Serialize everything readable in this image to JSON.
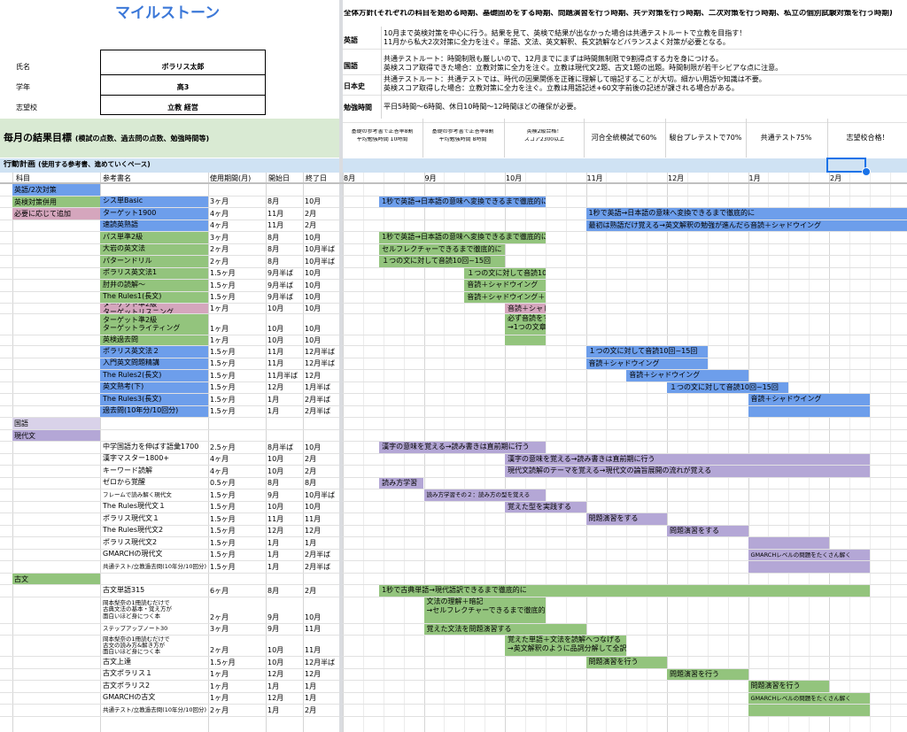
{
  "title": "マイルストーン",
  "overall_plan": {
    "heading": "全体方針(それぞれの科目を始める時期、基礎固めをする時期、問題演習を行う時期、共テ対策を行う時期、二次対策を行う時期、私立の個別試験対策を行う時期)",
    "rows": [
      {
        "label": "英語",
        "lines": [
          "10月まで英検対策を中心に行う。結果を見て、英検で結果が出なかった場合は共通テストルートで立教を目指す！",
          "11月から私大2次対策に全力を注ぐ。単語、文法、英文解釈、長文読解などバランスよく対策が必要となる。"
        ]
      },
      {
        "label": "国語",
        "lines": [
          "共通テストルート：時間制限も厳しいので、12月までにまずは時間無制限で9割得点する力を身につける。",
          "英検スコア取得できた場合：立教対策に全力を注ぐ。立教は現代文2題、古文1題の出題。時間制限が若干シビアな点に注意。"
        ]
      },
      {
        "label": "日本史",
        "lines": [
          "共通テストルート：共通テストでは、時代の因果関係を正確に理解して暗記することが大切。細かい用語や知識は不要。",
          "英検スコア取得した場合：立教対策に全力を注ぐ。立教は用語記述+60文字前後の記述が課される場合がある。"
        ]
      },
      {
        "label": "勉強時間",
        "lines": [
          "平日5時間〜6時間、休日10時間〜12時間ほどの確保が必要。"
        ]
      }
    ]
  },
  "profile": {
    "name_label": "氏名",
    "name_value": "ボラリス太郎",
    "grade_label": "学年",
    "grade_value": "高3",
    "school_label": "志望校",
    "school_value": "立教 経営"
  },
  "monthly_goals": {
    "label": "毎月の結果目標",
    "sub": "(模試の点数、過去問の点数、勉強時間等)",
    "goals": [
      {
        "lines": [
          "基礎の参考書で正答率8割",
          "平均勉強時間 10時間"
        ]
      },
      {
        "lines": [
          "基礎の参考書で正答率8割",
          "平均勉強時間 8時間"
        ]
      },
      {
        "lines": [
          "英検2級合格！",
          "スコア2300以上"
        ]
      },
      {
        "lines": [
          "河合全統模試で60%"
        ]
      },
      {
        "lines": [
          "駿台プレテストで70%"
        ]
      },
      {
        "lines": [
          "共通テスト75%"
        ]
      },
      {
        "lines": [
          "志望校合格！"
        ]
      }
    ]
  },
  "action_plan": {
    "label": "行動計画",
    "sub": "(使用する参考書、進めていくペース)"
  },
  "columns": {
    "subject": "科目",
    "book": "参考書名",
    "period": "使用期間(月)",
    "start": "開始日",
    "end": "終了日",
    "months": [
      "8月",
      "9月",
      "10月",
      "11月",
      "12月",
      "1月",
      "2月"
    ]
  },
  "accent": {
    "green": "#93c47d",
    "blue": "#6d9eeb",
    "purple": "#b4a7d6",
    "pink": "#d5a6bd",
    "selection": "#1a73e8"
  },
  "rows": [
    {
      "subject": "英語/2次対策",
      "sc": "blue",
      "book": "",
      "period": "",
      "start": "",
      "end": ""
    },
    {
      "subject": "英検対策併用",
      "sc": "green",
      "book": "シス単Basic",
      "bc": "blue",
      "period": "3ヶ月",
      "start": "8月",
      "end": "10月"
    },
    {
      "subject": "必要に応じて追加",
      "sc": "pink",
      "book": "ターゲット1900",
      "bc": "blue",
      "period": "4ヶ月",
      "start": "11月",
      "end": "2月"
    },
    {
      "subject": "",
      "book": "速読英熟語",
      "bc": "blue",
      "period": "4ヶ月",
      "start": "11月",
      "end": "2月"
    },
    {
      "subject": "",
      "book": "パス単準2級",
      "bc": "green",
      "period": "3ヶ月",
      "start": "8月",
      "end": "10月"
    },
    {
      "subject": "",
      "book": "大岩の英文法",
      "bc": "green",
      "period": "2ヶ月",
      "start": "8月",
      "end": "10月半ば"
    },
    {
      "subject": "",
      "book": "パターンドリル",
      "bc": "green",
      "period": "2ヶ月",
      "start": "8月",
      "end": "10月半ば"
    },
    {
      "subject": "",
      "book": "ポラリス英文法1",
      "bc": "green",
      "period": "1.5ヶ月",
      "start": "9月半ば",
      "end": "10月"
    },
    {
      "subject": "",
      "book": "肘井の読解〜",
      "bc": "green",
      "period": "1.5ヶ月",
      "start": "9月半ば",
      "end": "10月"
    },
    {
      "subject": "",
      "book": "The Rules1(長文)",
      "bc": "green",
      "period": "1.5ヶ月",
      "start": "9月半ば",
      "end": "10月"
    },
    {
      "subject": "",
      "book": "ターゲット準2級 / ターゲットリスニング",
      "bc": "pink",
      "period": "1ヶ月",
      "start": "10月",
      "end": "10月"
    },
    {
      "subject": "",
      "book": "ターゲット準2級 / ターゲットライティング",
      "bc": "green",
      "period": "1ヶ月",
      "start": "10月",
      "end": "10月"
    },
    {
      "subject": "",
      "book": "英検過去問",
      "bc": "green",
      "period": "1ヶ月",
      "start": "10月",
      "end": "10月"
    },
    {
      "subject": "",
      "book": "ポラリス英文法２",
      "bc": "blue",
      "period": "1.5ヶ月",
      "start": "11月",
      "end": "12月半ば"
    },
    {
      "subject": "",
      "book": "入門英文問題精講",
      "bc": "blue",
      "period": "1.5ヶ月",
      "start": "11月",
      "end": "12月半ば"
    },
    {
      "subject": "",
      "book": "The Rules2(長文)",
      "bc": "blue",
      "period": "1.5ヶ月",
      "start": "11月半ば",
      "end": "12月"
    },
    {
      "subject": "",
      "book": "英文熟考(下)",
      "bc": "blue",
      "period": "1.5ヶ月",
      "start": "12月",
      "end": "1月半ば"
    },
    {
      "subject": "",
      "book": "The Rules3(長文)",
      "bc": "blue",
      "period": "1.5ヶ月",
      "start": "1月",
      "end": "2月半ば"
    },
    {
      "subject": "",
      "book": "過去問(10年分/10回分)",
      "bc": "blue",
      "period": "1.5ヶ月",
      "start": "1月",
      "end": "2月半ば"
    },
    {
      "subject": "国語",
      "sc": "lpurple",
      "book": "",
      "period": "",
      "start": "",
      "end": ""
    },
    {
      "subject": "現代文",
      "sc": "purple",
      "book": "",
      "period": "",
      "start": "",
      "end": ""
    },
    {
      "subject": "",
      "book": "中学国語力を伸ばす語彙1700",
      "period": "2.5ヶ月",
      "start": "8月半ば",
      "end": "10月"
    },
    {
      "subject": "",
      "book": "漢字マスター1800+",
      "period": "4ヶ月",
      "start": "10月",
      "end": "2月"
    },
    {
      "subject": "",
      "book": "キーワード読解",
      "period": "4ヶ月",
      "start": "10月",
      "end": "2月"
    },
    {
      "subject": "",
      "book": "ゼロから覚醒",
      "period": "0.5ヶ月",
      "start": "8月",
      "end": "8月"
    },
    {
      "subject": "",
      "book": "フレームで読み解く現代文",
      "bookSize": "xs",
      "period": "1.5ヶ月",
      "start": "9月",
      "end": "10月半ば"
    },
    {
      "subject": "",
      "book": "The Rules現代文１",
      "period": "1.5ヶ月",
      "start": "10月",
      "end": "10月"
    },
    {
      "subject": "",
      "book": "ポラリス現代文１",
      "period": "1.5ヶ月",
      "start": "11月",
      "end": "11月"
    },
    {
      "subject": "",
      "book": "The Rules現代文2",
      "period": "1.5ヶ月",
      "start": "12月",
      "end": "12月"
    },
    {
      "subject": "",
      "book": "ポラリス現代文2",
      "period": "1.5ヶ月",
      "start": "1月",
      "end": "1月"
    },
    {
      "subject": "",
      "book": "GMARCHの現代文",
      "period": "1.5ヶ月",
      "start": "1月",
      "end": "2月半ば"
    },
    {
      "subject": "",
      "book": "共通テスト/立教過去問(10年分/10回分)",
      "bookSize": "xs",
      "period": "1.5ヶ月",
      "start": "1月",
      "end": "2月半ば"
    },
    {
      "subject": "古文",
      "sc": "green",
      "book": "",
      "period": "",
      "start": "",
      "end": ""
    },
    {
      "subject": "",
      "book": "古文単語315",
      "period": "6ヶ月",
      "start": "8月",
      "end": "2月"
    },
    {
      "subject": "",
      "book": "岡本梨奈の1冊読むだけで / 古典文法の基本・覚え方が / 面白いほど身につく本",
      "bookSize": "xs",
      "period": "2ヶ月",
      "start": "9月",
      "end": "10月"
    },
    {
      "subject": "",
      "book": "ステップアップノート30",
      "bookSize": "xs",
      "period": "3ヶ月",
      "start": "9月",
      "end": "11月"
    },
    {
      "subject": "",
      "book": "岡本梨奈の1冊読むだけで / 古文の読み方&解き方が / 面白いほど身につく本",
      "bookSize": "xs",
      "period": "2ヶ月",
      "start": "10月",
      "end": "11月"
    },
    {
      "subject": "",
      "book": "古文上達",
      "period": "1.5ヶ月",
      "start": "10月",
      "end": "12月半ば"
    },
    {
      "subject": "",
      "book": "古文ポラリス１",
      "period": "1ヶ月",
      "start": "12月",
      "end": "12月"
    },
    {
      "subject": "",
      "book": "古文ポラリス2",
      "period": "1ヶ月",
      "start": "1月",
      "end": "1月"
    },
    {
      "subject": "",
      "book": "GMARCHの古文",
      "period": "1ヶ月",
      "start": "12月",
      "end": "1月"
    },
    {
      "subject": "",
      "book": "共通テスト/立教過去問(10年分/10回分)",
      "bookSize": "xs",
      "period": "2ヶ月",
      "start": "1月",
      "end": "2月"
    }
  ],
  "bars": [
    {
      "row": 1,
      "from": 0.45,
      "to": 2.5,
      "color": "blue",
      "text": "1秒で英語→日本語の意味へ変換できるまで徹底的に"
    },
    {
      "row": 2,
      "from": 3.0,
      "to": 7.0,
      "color": "blue",
      "text": "1秒で英語→日本語の意味へ変換できるまで徹底的に"
    },
    {
      "row": 3,
      "from": 3.0,
      "to": 7.0,
      "color": "blue",
      "text": "最初は熟語だけ覚える→英文解釈の勉強が進んだら音読＋シャドウイング"
    },
    {
      "row": 4,
      "from": 0.45,
      "to": 2.5,
      "color": "green",
      "text": "1秒で英語→日本語の意味へ変換できるまで徹底的に"
    },
    {
      "row": 5,
      "from": 0.45,
      "to": 2.0,
      "color": "green",
      "text": "セルフレクチャーできるまで徹底的に"
    },
    {
      "row": 6,
      "from": 0.45,
      "to": 2.0,
      "color": "green",
      "text": "１つの文に対して音読10回~15回"
    },
    {
      "row": 7,
      "from": 1.5,
      "to": 2.5,
      "color": "green",
      "text": "１つの文に対して音読10回~15回"
    },
    {
      "row": 8,
      "from": 1.5,
      "to": 2.5,
      "color": "green",
      "text": "音読＋シャドウイング"
    },
    {
      "row": 9,
      "from": 1.5,
      "to": 2.5,
      "color": "green",
      "text": "音読＋シャドウイング＋ 要約をする"
    },
    {
      "row": 10,
      "from": 2.0,
      "to": 2.5,
      "color": "pink",
      "text": "音読＋シャドウイング"
    },
    {
      "row": 11,
      "from": 2.0,
      "to": 2.5,
      "color": "green",
      "text": "必ず音読をすること",
      "text2": "→1つの文章につき5回"
    },
    {
      "row": 12,
      "from": 2.0,
      "to": 2.5,
      "color": "green",
      "text": ""
    },
    {
      "row": 13,
      "from": 3.0,
      "to": 4.5,
      "color": "blue",
      "text": "１つの文に対して音読10回~15回"
    },
    {
      "row": 14,
      "from": 3.0,
      "to": 4.5,
      "color": "blue",
      "text": "音読＋シャドウイング"
    },
    {
      "row": 15,
      "from": 3.5,
      "to": 5.0,
      "color": "blue",
      "text": "音読＋シャドウイング"
    },
    {
      "row": 16,
      "from": 4.0,
      "to": 5.5,
      "color": "blue",
      "text": "１つの文に対して音読10回~15回"
    },
    {
      "row": 17,
      "from": 5.0,
      "to": 6.5,
      "color": "blue",
      "text": "音読＋シャドウイング"
    },
    {
      "row": 18,
      "from": 5.0,
      "to": 6.5,
      "color": "blue",
      "text": ""
    },
    {
      "row": 21,
      "from": 0.45,
      "to": 2.5,
      "color": "purple",
      "text": "漢字の意味を覚える→読み書きは直前期に行う"
    },
    {
      "row": 22,
      "from": 2.0,
      "to": 6.5,
      "color": "purple",
      "text": "漢字の意味を覚える→読み書きは直前期に行う"
    },
    {
      "row": 23,
      "from": 2.0,
      "to": 6.5,
      "color": "purple",
      "text": "現代文読解のテーマを覚える→現代文の論旨展開の流れが覚える"
    },
    {
      "row": 24,
      "from": 0.45,
      "to": 1.0,
      "color": "purple",
      "text": "読み方学習"
    },
    {
      "row": 25,
      "from": 1.0,
      "to": 2.5,
      "color": "purple",
      "text": "読み方学習その２：読み方の型を覚える",
      "size": "xs"
    },
    {
      "row": 26,
      "from": 2.0,
      "to": 3.0,
      "color": "purple",
      "text": "覚えた型を実践する"
    },
    {
      "row": 27,
      "from": 3.0,
      "to": 4.0,
      "color": "purple",
      "text": "問題演習をする"
    },
    {
      "row": 28,
      "from": 4.0,
      "to": 5.0,
      "color": "purple",
      "text": "問題演習をする"
    },
    {
      "row": 29,
      "from": 5.0,
      "to": 6.0,
      "color": "purple",
      "text": ""
    },
    {
      "row": 30,
      "from": 5.0,
      "to": 6.5,
      "color": "purple",
      "text": "GMARCHレベルの問題をたくさん解く",
      "size": "xs"
    },
    {
      "row": 31,
      "from": 5.0,
      "to": 6.5,
      "color": "purple",
      "text": ""
    },
    {
      "row": 33,
      "from": 0.45,
      "to": 6.5,
      "color": "green",
      "text": "1秒で古典単語→現代語訳できるまで徹底的に"
    },
    {
      "row": 34,
      "from": 1.0,
      "to": 2.5,
      "color": "green",
      "text": "文法の理解＋暗記",
      "text2": "→セルフレクチャーできるまで徹底的に"
    },
    {
      "row": 35,
      "from": 1.0,
      "to": 3.0,
      "color": "green",
      "text": "覚えた文法を問題演習する"
    },
    {
      "row": 36,
      "from": 2.0,
      "to": 3.5,
      "color": "green",
      "text": "覚えた単語＋文法を読解へつなげる",
      "text2": "→英文解釈のように品詞分解して全訳する"
    },
    {
      "row": 37,
      "from": 3.0,
      "to": 4.0,
      "color": "green",
      "text": "問題演習を行う"
    },
    {
      "row": 38,
      "from": 4.0,
      "to": 5.0,
      "color": "green",
      "text": "問題演習を行う"
    },
    {
      "row": 39,
      "from": 5.0,
      "to": 6.0,
      "color": "green",
      "text": "問題演習を行う"
    },
    {
      "row": 40,
      "from": 5.0,
      "to": 6.5,
      "color": "green",
      "text": "GMARCHレベルの問題をたくさん解く",
      "size": "xs"
    },
    {
      "row": 41,
      "from": 5.0,
      "to": 6.5,
      "color": "green",
      "text": ""
    }
  ]
}
